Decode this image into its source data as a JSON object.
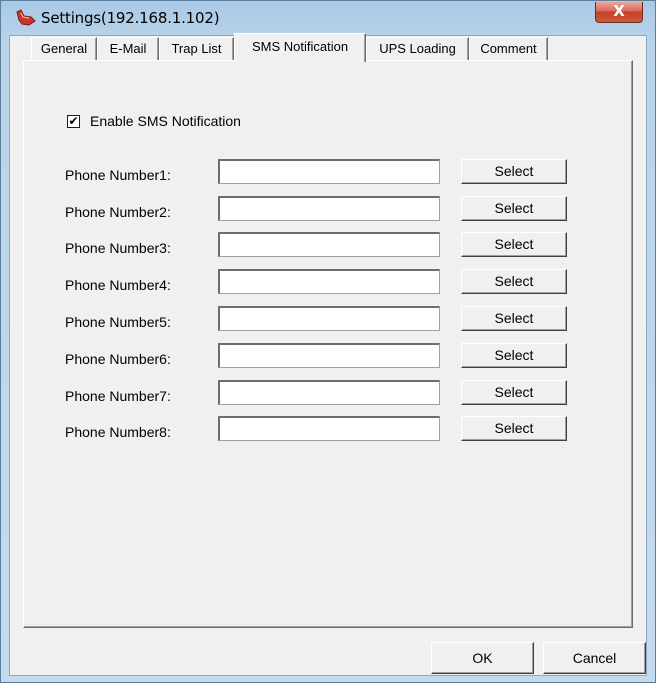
{
  "window": {
    "title": "Settings(192.168.1.102)",
    "close_label": "X"
  },
  "tabs": [
    {
      "label": "General",
      "active": false
    },
    {
      "label": "E-Mail",
      "active": false
    },
    {
      "label": "Trap List",
      "active": false
    },
    {
      "label": "SMS Notification",
      "active": true
    },
    {
      "label": "UPS Loading",
      "active": false
    },
    {
      "label": "Comment",
      "active": false
    }
  ],
  "sms": {
    "enable_label": "Enable SMS Notification",
    "enable_checked": true,
    "check_mark": "✔",
    "phones": [
      {
        "label": "Phone Number1:",
        "value": "",
        "button": "Select"
      },
      {
        "label": "Phone Number2:",
        "value": "",
        "button": "Select"
      },
      {
        "label": "Phone Number3:",
        "value": "",
        "button": "Select"
      },
      {
        "label": "Phone Number4:",
        "value": "",
        "button": "Select"
      },
      {
        "label": "Phone Number5:",
        "value": "",
        "button": "Select"
      },
      {
        "label": "Phone Number6:",
        "value": "",
        "button": "Select"
      },
      {
        "label": "Phone Number7:",
        "value": "",
        "button": "Select"
      },
      {
        "label": "Phone Number8:",
        "value": "",
        "button": "Select"
      }
    ]
  },
  "footer": {
    "ok_label": "OK",
    "cancel_label": "Cancel"
  }
}
